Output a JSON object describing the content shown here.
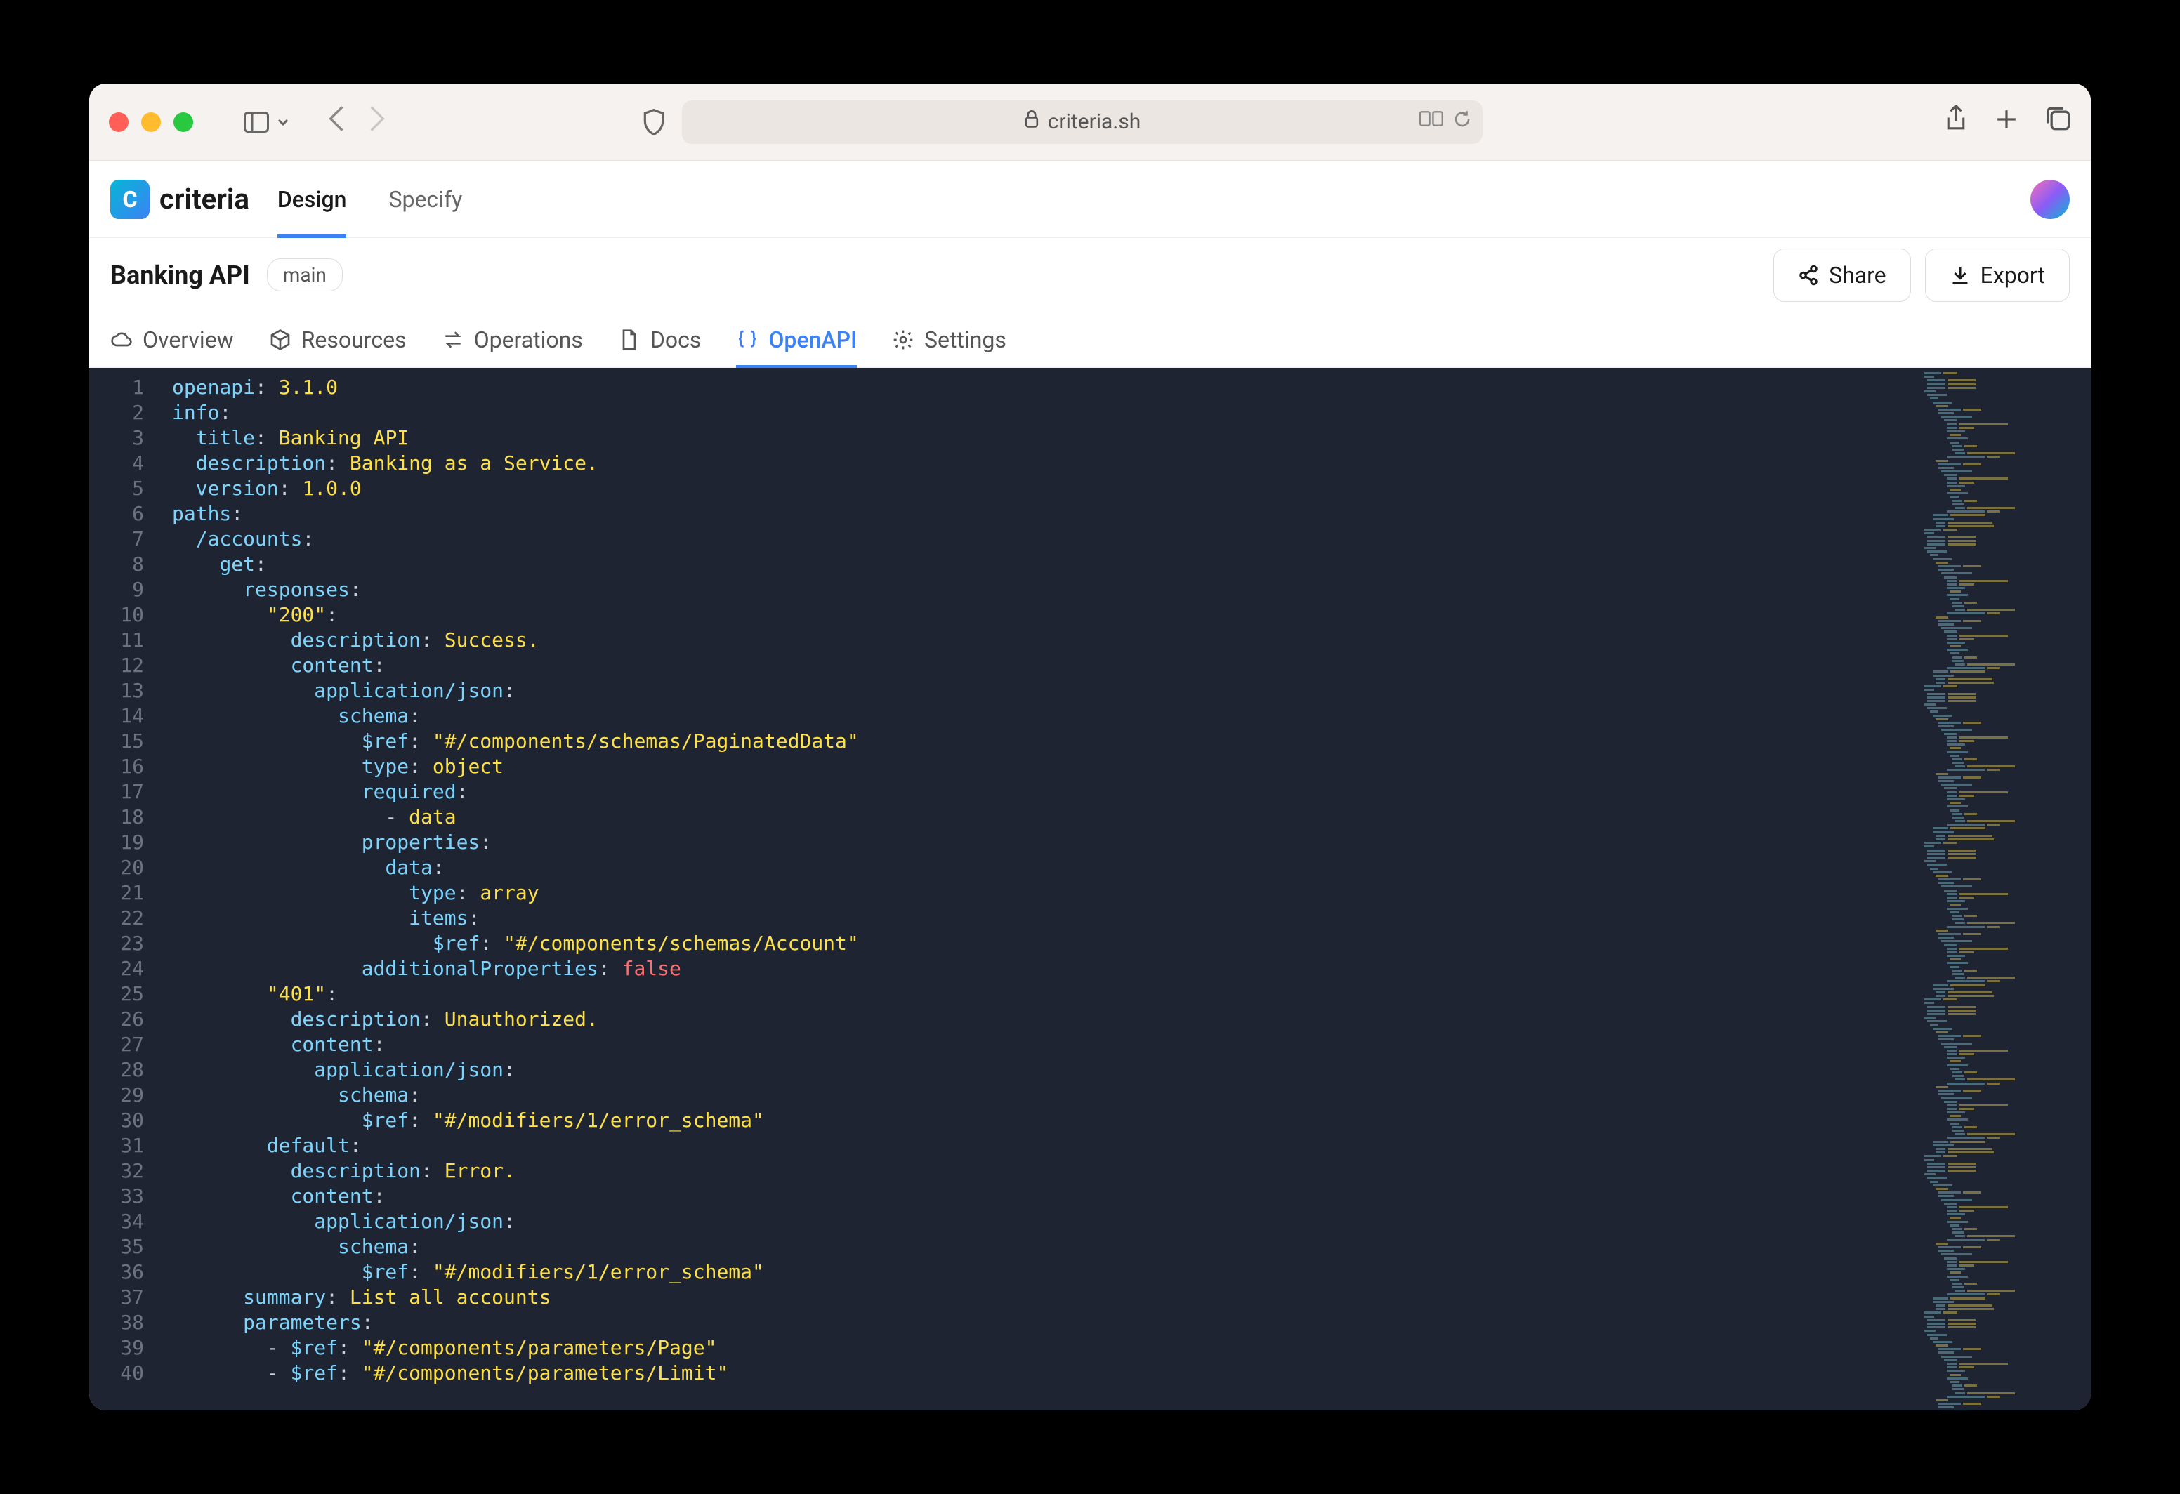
{
  "browser": {
    "url_host": "criteria.sh"
  },
  "app": {
    "logo_text": "criteria",
    "tabs": [
      {
        "label": "Design",
        "active": true
      },
      {
        "label": "Specify",
        "active": false
      }
    ]
  },
  "project": {
    "title": "Banking API",
    "branch": "main",
    "share_label": "Share",
    "export_label": "Export"
  },
  "sub_tabs": [
    {
      "label": "Overview",
      "icon": "cloud"
    },
    {
      "label": "Resources",
      "icon": "package"
    },
    {
      "label": "Operations",
      "icon": "swap"
    },
    {
      "label": "Docs",
      "icon": "file"
    },
    {
      "label": "OpenAPI",
      "icon": "braces",
      "active": true
    },
    {
      "label": "Settings",
      "icon": "gear"
    }
  ],
  "code": [
    {
      "n": 1,
      "tokens": [
        [
          "key",
          "openapi"
        ],
        [
          "punct",
          ": "
        ],
        [
          "str",
          "3.1.0"
        ]
      ]
    },
    {
      "n": 2,
      "tokens": [
        [
          "key",
          "info"
        ],
        [
          "punct",
          ":"
        ]
      ]
    },
    {
      "n": 3,
      "tokens": [
        [
          "punct",
          "  "
        ],
        [
          "key",
          "title"
        ],
        [
          "punct",
          ": "
        ],
        [
          "str",
          "Banking API"
        ]
      ]
    },
    {
      "n": 4,
      "tokens": [
        [
          "punct",
          "  "
        ],
        [
          "key",
          "description"
        ],
        [
          "punct",
          ": "
        ],
        [
          "str",
          "Banking as a Service."
        ]
      ]
    },
    {
      "n": 5,
      "tokens": [
        [
          "punct",
          "  "
        ],
        [
          "key",
          "version"
        ],
        [
          "punct",
          ": "
        ],
        [
          "str",
          "1.0.0"
        ]
      ]
    },
    {
      "n": 6,
      "tokens": [
        [
          "key",
          "paths"
        ],
        [
          "punct",
          ":"
        ]
      ]
    },
    {
      "n": 7,
      "tokens": [
        [
          "punct",
          "  "
        ],
        [
          "key",
          "/accounts"
        ],
        [
          "punct",
          ":"
        ]
      ]
    },
    {
      "n": 8,
      "tokens": [
        [
          "punct",
          "    "
        ],
        [
          "key",
          "get"
        ],
        [
          "punct",
          ":"
        ]
      ]
    },
    {
      "n": 9,
      "tokens": [
        [
          "punct",
          "      "
        ],
        [
          "key",
          "responses"
        ],
        [
          "punct",
          ":"
        ]
      ]
    },
    {
      "n": 10,
      "tokens": [
        [
          "punct",
          "        "
        ],
        [
          "str",
          "\"200\""
        ],
        [
          "punct",
          ":"
        ]
      ]
    },
    {
      "n": 11,
      "tokens": [
        [
          "punct",
          "          "
        ],
        [
          "key",
          "description"
        ],
        [
          "punct",
          ": "
        ],
        [
          "str",
          "Success."
        ]
      ]
    },
    {
      "n": 12,
      "tokens": [
        [
          "punct",
          "          "
        ],
        [
          "key",
          "content"
        ],
        [
          "punct",
          ":"
        ]
      ]
    },
    {
      "n": 13,
      "tokens": [
        [
          "punct",
          "            "
        ],
        [
          "key",
          "application/json"
        ],
        [
          "punct",
          ":"
        ]
      ]
    },
    {
      "n": 14,
      "tokens": [
        [
          "punct",
          "              "
        ],
        [
          "key",
          "schema"
        ],
        [
          "punct",
          ":"
        ]
      ]
    },
    {
      "n": 15,
      "tokens": [
        [
          "punct",
          "                "
        ],
        [
          "key",
          "$ref"
        ],
        [
          "punct",
          ": "
        ],
        [
          "str",
          "\"#/components/schemas/PaginatedData\""
        ]
      ]
    },
    {
      "n": 16,
      "tokens": [
        [
          "punct",
          "                "
        ],
        [
          "key",
          "type"
        ],
        [
          "punct",
          ": "
        ],
        [
          "str",
          "object"
        ]
      ]
    },
    {
      "n": 17,
      "tokens": [
        [
          "punct",
          "                "
        ],
        [
          "key",
          "required"
        ],
        [
          "punct",
          ":"
        ]
      ]
    },
    {
      "n": 18,
      "tokens": [
        [
          "punct",
          "                  - "
        ],
        [
          "str",
          "data"
        ]
      ]
    },
    {
      "n": 19,
      "tokens": [
        [
          "punct",
          "                "
        ],
        [
          "key",
          "properties"
        ],
        [
          "punct",
          ":"
        ]
      ]
    },
    {
      "n": 20,
      "tokens": [
        [
          "punct",
          "                  "
        ],
        [
          "key",
          "data"
        ],
        [
          "punct",
          ":"
        ]
      ]
    },
    {
      "n": 21,
      "tokens": [
        [
          "punct",
          "                    "
        ],
        [
          "key",
          "type"
        ],
        [
          "punct",
          ": "
        ],
        [
          "str",
          "array"
        ]
      ]
    },
    {
      "n": 22,
      "tokens": [
        [
          "punct",
          "                    "
        ],
        [
          "key",
          "items"
        ],
        [
          "punct",
          ":"
        ]
      ]
    },
    {
      "n": 23,
      "tokens": [
        [
          "punct",
          "                      "
        ],
        [
          "key",
          "$ref"
        ],
        [
          "punct",
          ": "
        ],
        [
          "str",
          "\"#/components/schemas/Account\""
        ]
      ]
    },
    {
      "n": 24,
      "tokens": [
        [
          "punct",
          "                "
        ],
        [
          "key",
          "additionalProperties"
        ],
        [
          "punct",
          ": "
        ],
        [
          "bool",
          "false"
        ]
      ]
    },
    {
      "n": 25,
      "tokens": [
        [
          "punct",
          "        "
        ],
        [
          "str",
          "\"401\""
        ],
        [
          "punct",
          ":"
        ]
      ]
    },
    {
      "n": 26,
      "tokens": [
        [
          "punct",
          "          "
        ],
        [
          "key",
          "description"
        ],
        [
          "punct",
          ": "
        ],
        [
          "str",
          "Unauthorized."
        ]
      ]
    },
    {
      "n": 27,
      "tokens": [
        [
          "punct",
          "          "
        ],
        [
          "key",
          "content"
        ],
        [
          "punct",
          ":"
        ]
      ]
    },
    {
      "n": 28,
      "tokens": [
        [
          "punct",
          "            "
        ],
        [
          "key",
          "application/json"
        ],
        [
          "punct",
          ":"
        ]
      ]
    },
    {
      "n": 29,
      "tokens": [
        [
          "punct",
          "              "
        ],
        [
          "key",
          "schema"
        ],
        [
          "punct",
          ":"
        ]
      ]
    },
    {
      "n": 30,
      "tokens": [
        [
          "punct",
          "                "
        ],
        [
          "key",
          "$ref"
        ],
        [
          "punct",
          ": "
        ],
        [
          "str",
          "\"#/modifiers/1/error_schema\""
        ]
      ]
    },
    {
      "n": 31,
      "tokens": [
        [
          "punct",
          "        "
        ],
        [
          "key",
          "default"
        ],
        [
          "punct",
          ":"
        ]
      ]
    },
    {
      "n": 32,
      "tokens": [
        [
          "punct",
          "          "
        ],
        [
          "key",
          "description"
        ],
        [
          "punct",
          ": "
        ],
        [
          "str",
          "Error."
        ]
      ]
    },
    {
      "n": 33,
      "tokens": [
        [
          "punct",
          "          "
        ],
        [
          "key",
          "content"
        ],
        [
          "punct",
          ":"
        ]
      ]
    },
    {
      "n": 34,
      "tokens": [
        [
          "punct",
          "            "
        ],
        [
          "key",
          "application/json"
        ],
        [
          "punct",
          ":"
        ]
      ]
    },
    {
      "n": 35,
      "tokens": [
        [
          "punct",
          "              "
        ],
        [
          "key",
          "schema"
        ],
        [
          "punct",
          ":"
        ]
      ]
    },
    {
      "n": 36,
      "tokens": [
        [
          "punct",
          "                "
        ],
        [
          "key",
          "$ref"
        ],
        [
          "punct",
          ": "
        ],
        [
          "str",
          "\"#/modifiers/1/error_schema\""
        ]
      ]
    },
    {
      "n": 37,
      "tokens": [
        [
          "punct",
          "      "
        ],
        [
          "key",
          "summary"
        ],
        [
          "punct",
          ": "
        ],
        [
          "str",
          "List all accounts"
        ]
      ]
    },
    {
      "n": 38,
      "tokens": [
        [
          "punct",
          "      "
        ],
        [
          "key",
          "parameters"
        ],
        [
          "punct",
          ":"
        ]
      ]
    },
    {
      "n": 39,
      "tokens": [
        [
          "punct",
          "        - "
        ],
        [
          "key",
          "$ref"
        ],
        [
          "punct",
          ": "
        ],
        [
          "str",
          "\"#/components/parameters/Page\""
        ]
      ]
    },
    {
      "n": 40,
      "tokens": [
        [
          "punct",
          "        - "
        ],
        [
          "key",
          "$ref"
        ],
        [
          "punct",
          ": "
        ],
        [
          "str",
          "\"#/components/parameters/Limit\""
        ]
      ]
    }
  ]
}
